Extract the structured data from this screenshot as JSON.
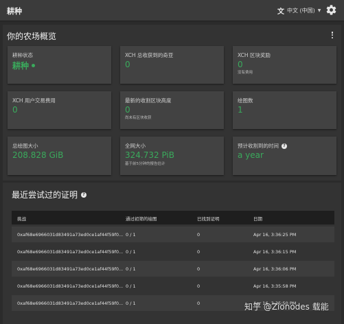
{
  "header": {
    "title": "耕种",
    "language": "中文 (中国)"
  },
  "overview": {
    "title": "你的农场概览",
    "cards": [
      {
        "label": "耕种状态",
        "value": "耕种",
        "sub": ""
      },
      {
        "label": "XCH 总收获到的奇亚",
        "value": "0",
        "sub": ""
      },
      {
        "label": "XCH 区块奖励",
        "value": "0",
        "sub": "没有费用"
      },
      {
        "label": "XCH 用户交易费用",
        "value": "0",
        "sub": ""
      },
      {
        "label": "最新的收割区块高度",
        "value": "0",
        "sub": "尚未有区块收获"
      },
      {
        "label": "绘图数",
        "value": "1",
        "sub": ""
      },
      {
        "label": "总绘图大小",
        "value": "208.828 GiB",
        "sub": ""
      },
      {
        "label": "全网大小",
        "value": "324.732 PiB",
        "sub": "基于前5分钟的报告估计"
      },
      {
        "label": "预计收割到的时间",
        "value": "a year",
        "sub": ""
      }
    ]
  },
  "proofs": {
    "title": "最近尝试过的证明",
    "columns": [
      "挑战",
      "通过初筛的绘图",
      "已找到证明",
      "日期"
    ],
    "rows": [
      {
        "challenge": "0xaf68e6966031d83491a73ed0ce1af44f59f0...",
        "plots": "0 / 1",
        "proofs": "0",
        "date": "Apr 16, 3:36:25 PM"
      },
      {
        "challenge": "0xaf68e6966031d83491a73ed0ce1af44f59f0...",
        "plots": "0 / 1",
        "proofs": "0",
        "date": "Apr 16, 3:36:15 PM"
      },
      {
        "challenge": "0xaf68e6966031d83491a73ed0ce1af44f59f0...",
        "plots": "0 / 1",
        "proofs": "0",
        "date": "Apr 16, 3:36:06 PM"
      },
      {
        "challenge": "0xaf68e6966031d83491a73ed0ce1af44f59f0...",
        "plots": "0 / 1",
        "proofs": "0",
        "date": "Apr 16, 3:35:58 PM"
      },
      {
        "challenge": "0xaf68e6966031d83491a73ed0ce1af44f59f0...",
        "plots": "0 / 1",
        "proofs": "0",
        "date": "Apr 16, 3:35:50 PM"
      }
    ]
  },
  "watermark": "知乎 @Zionodes 载能",
  "colors": {
    "accent": "#3aaa5c",
    "background": "#2b2b2b",
    "card": "#424242"
  }
}
